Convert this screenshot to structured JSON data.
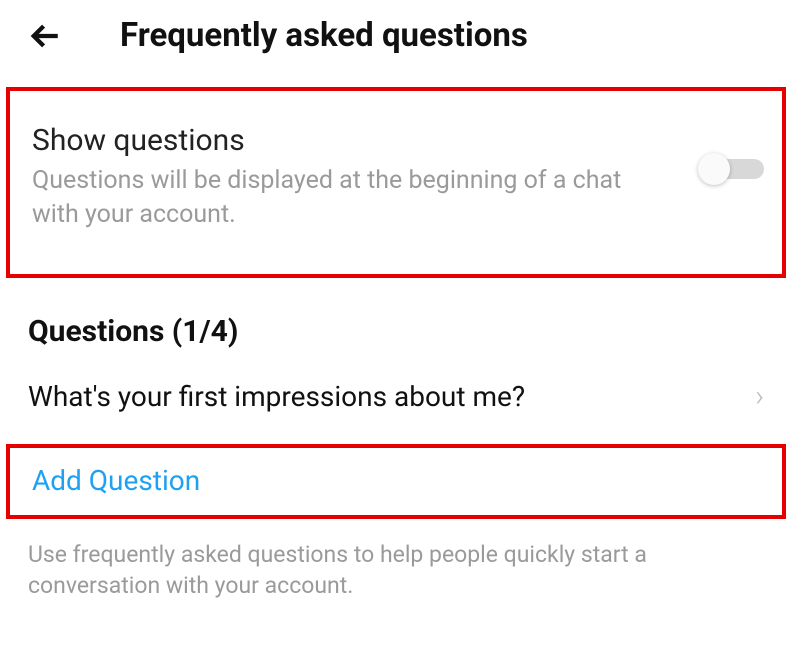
{
  "header": {
    "title": "Frequently asked questions"
  },
  "showQuestions": {
    "title": "Show questions",
    "description": "Questions will be displayed at the beginning of a chat with your account.",
    "enabled": false
  },
  "sectionTitle": "Questions (1/4)",
  "questions": [
    {
      "label": "What's your first impressions about me?"
    }
  ],
  "addQuestion": "Add Question",
  "helper": "Use frequently asked questions to help people quickly start a conversation with your account."
}
